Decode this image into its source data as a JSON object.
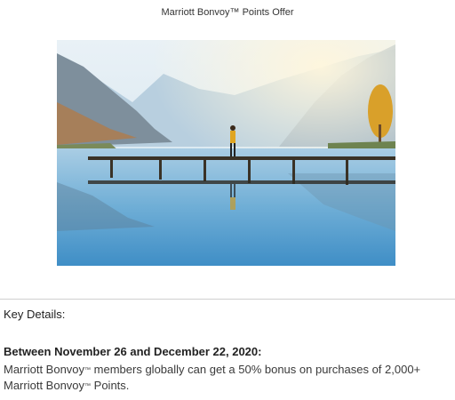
{
  "header": {
    "title": "Marriott Bonvoy™ Points Offer"
  },
  "hero_image": {
    "alt": "Person standing on a wooden bridge over a calm mountain lake"
  },
  "details": {
    "heading": "Key Details:",
    "period": "Between November 26 and December 22, 2020:",
    "line1_a": "Marriott Bonvoy",
    "line1_tm": "™",
    "line1_b": " members globally can get a 50% bonus on purchases of 2,000+",
    "line2_a": "Marriott Bonvoy",
    "line2_tm": "™",
    "line2_b": " Points."
  }
}
